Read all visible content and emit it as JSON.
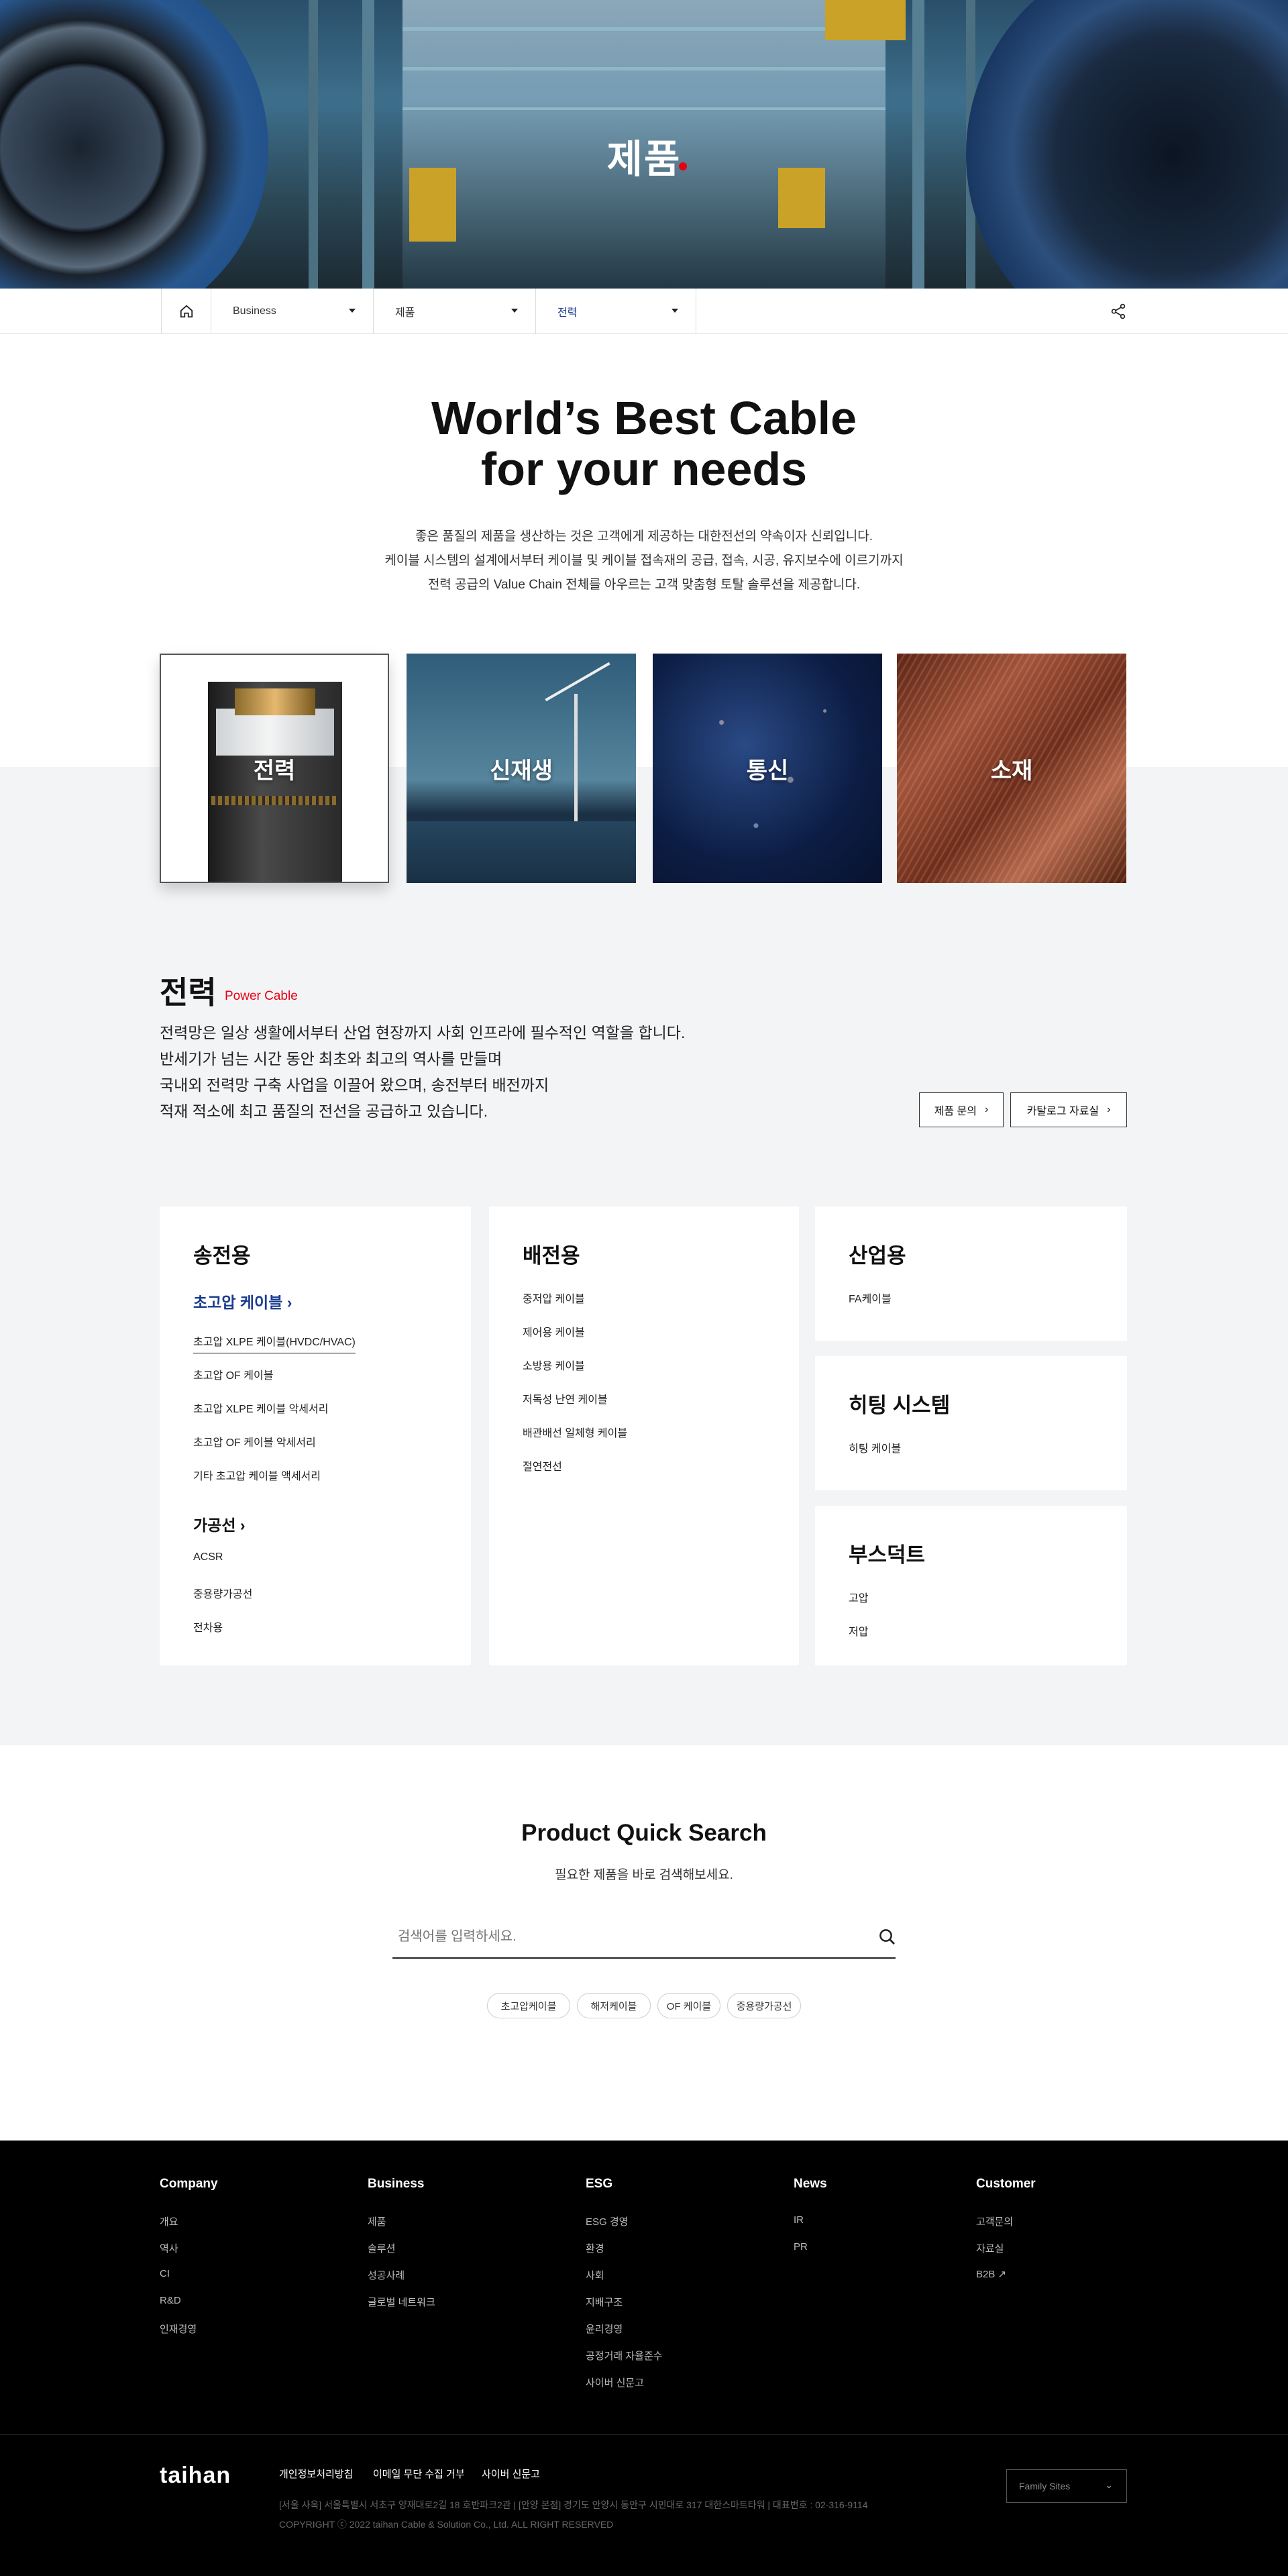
{
  "hero": {
    "title": "제품"
  },
  "breadcrumb": {
    "items": [
      {
        "label": "Business"
      },
      {
        "label": "제품"
      },
      {
        "label": "전력"
      }
    ]
  },
  "intro": {
    "headline_1": "World’s Best Cable",
    "headline_2": "for your needs",
    "lines": [
      "좋은 품질의 제품을 생산하는 것은 고객에게 제공하는 대한전선의 약속이자 신뢰입니다.",
      "케이블 시스템의 설계에서부터 케이블 및 케이블 접속재의 공급, 접속, 시공, 유지보수에 이르기까지",
      "전력 공급의 Value Chain 전체를 아우르는 고객 맞춤형 토탈 솔루션을 제공합니다."
    ]
  },
  "categories": [
    {
      "label": "전력"
    },
    {
      "label": "신재생"
    },
    {
      "label": "통신"
    },
    {
      "label": "소재"
    }
  ],
  "section": {
    "title": "전력",
    "subtitle": "Power Cable",
    "lines": [
      "전력망은 일상 생활에서부터 산업 현장까지 사회 인프라에 필수적인 역할을 합니다.",
      "반세기가 넘는 시간 동안 최초와 최고의 역사를 만들며",
      "국내외 전력망 구축 사업을 이끌어 왔으며, 송전부터 배전까지",
      "적재 적소에 최고 품질의 전선을 공급하고 있습니다."
    ],
    "inquiry_button": "제품 문의",
    "catalog_button": "카탈로그 자료실"
  },
  "cards": {
    "transmission": {
      "title": "송전용",
      "group1": "초고압 케이블",
      "group1_items": [
        "초고압 XLPE 케이블(HVDC/HVAC)",
        "초고압 OF 케이블",
        "초고압 XLPE 케이블 악세서리",
        "초고압 OF 케이블 악세서리",
        "기타 초고압 케이블 액세서리"
      ],
      "group2": "가공선",
      "group2_items": [
        "ACSR",
        "중용량가공선",
        "전차용"
      ]
    },
    "distribution": {
      "title": "배전용",
      "items": [
        "중저압 케이블",
        "제어용 케이블",
        "소방용 케이블",
        "저독성 난연 케이블",
        "배관배선 일체형 케이블",
        "절연전선"
      ]
    },
    "industrial": {
      "title": "산업용",
      "items": [
        "FA케이블"
      ]
    },
    "heating": {
      "title": "히팅 시스템",
      "items": [
        "히팅 케이블"
      ]
    },
    "products": {
      "title": "부스덕트",
      "items": [
        "고압",
        "저압"
      ]
    }
  },
  "quick_search": {
    "title": "Product Quick Search",
    "desc": "필요한 제품을 바로 검색해보세요.",
    "placeholder": "검색어를 입력하세요.",
    "tags": [
      "초고압케이블",
      "해저케이블",
      "OF 케이블",
      "중용량가공선"
    ]
  },
  "footer": {
    "columns": [
      {
        "title": "Company",
        "items": [
          "개요",
          "역사",
          "CI",
          "R&D",
          "인재경영"
        ]
      },
      {
        "title": "Business",
        "items": [
          "제품",
          "솔루션",
          "성공사례",
          "글로벌 네트워크"
        ]
      },
      {
        "title": "ESG",
        "items": [
          "ESG 경영",
          "환경",
          "사회",
          "지배구조",
          "윤리경영",
          "공정거래 자율준수",
          "사이버 신문고"
        ]
      },
      {
        "title": "News",
        "items": [
          "IR",
          "PR"
        ]
      },
      {
        "title": "Customer",
        "items": [
          "고객문의",
          "자료실",
          "B2B"
        ]
      }
    ],
    "logo": "taihan",
    "links": [
      "개인정보처리방침",
      "이메일 무단 수집 거부",
      "사이버 신문고"
    ],
    "address": "[서울 사옥] 서울특별시 서초구 양재대로2길 18 호반파크2관  |  [안양 본점] 경기도 안양시 동안구 시민대로 317 대한스마트타워  |  대표번호 : 02-316-9114",
    "copyright": "COPYRIGHT ⓒ 2022 taihan Cable & Solution Co., Ltd. ALL RIGHT RESERVED",
    "family_sites": "Family Sites"
  },
  "colors": {
    "accent": "#e60012",
    "link_blue": "#1a3b8f",
    "grey_bg": "#f3f4f6"
  }
}
